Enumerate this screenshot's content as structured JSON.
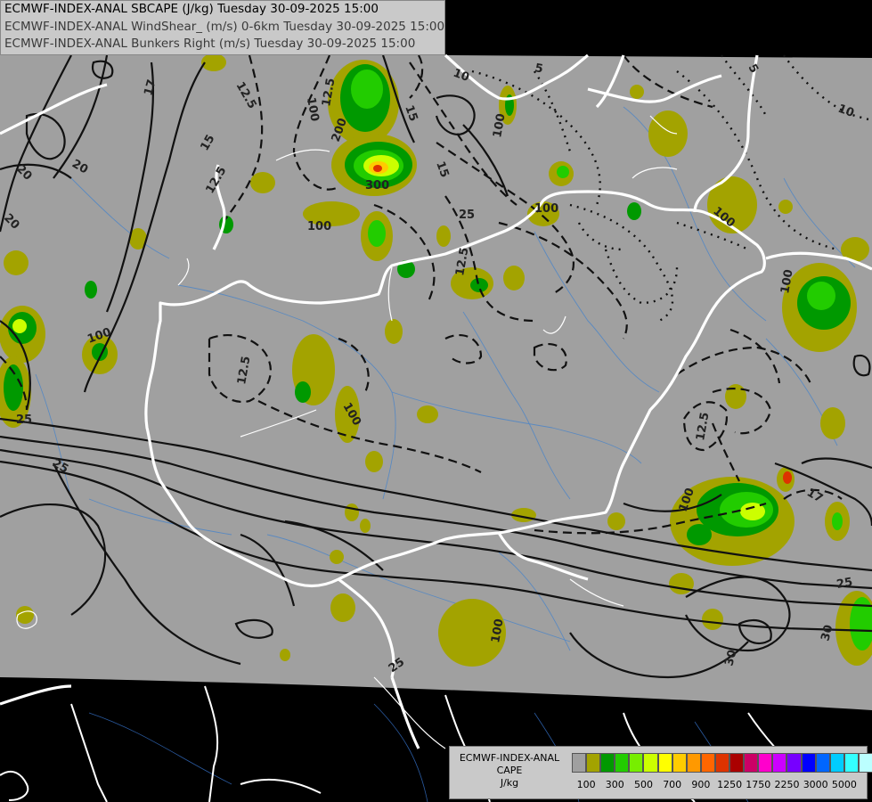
{
  "header": {
    "line1": "ECMWF-INDEX-ANAL SBCAPE (J/kg) Tuesday 30-09-2025 15:00",
    "line2": "ECMWF-INDEX-ANAL WindShear_ (m/s) 0-6km Tuesday 30-09-2025 15:00",
    "line3": "ECMWF-INDEX-ANAL Bunkers Right (m/s) Tuesday 30-09-2025 15:00"
  },
  "legend": {
    "title1": "ECMWF-INDEX-ANAL",
    "title2": "CAPE",
    "unit": "J/kg",
    "colors": [
      "#a0a0a0",
      "#a3a300",
      "#009900",
      "#22cc00",
      "#77ee00",
      "#ccff00",
      "#ffff00",
      "#ffcc00",
      "#ff9900",
      "#ff6600",
      "#dd3300",
      "#aa0000",
      "#cc0066",
      "#ff00cc",
      "#cc00ff",
      "#7700ff",
      "#0000ff",
      "#0066ff",
      "#00ccff",
      "#33ffff",
      "#bbffff",
      "#ffffff"
    ],
    "tick_labels": [
      "100",
      "300",
      "500",
      "700",
      "900",
      "1250",
      "1750",
      "2250",
      "3000",
      "5000"
    ]
  },
  "contour_labels": {
    "shear": [
      "17",
      "20",
      "20",
      "25",
      "25",
      "25",
      "30",
      "30",
      "17",
      "20",
      "25",
      "25"
    ],
    "bunkers": [
      "12.5",
      "12.5",
      "12.5",
      "12.5",
      "15",
      "15",
      "15",
      "10",
      "10",
      "5",
      "5",
      "12.5",
      "12.5"
    ],
    "cape": [
      "100",
      "100",
      "100",
      "100",
      "100",
      "100",
      "100",
      "100",
      "200",
      "300",
      "100",
      "100"
    ]
  }
}
